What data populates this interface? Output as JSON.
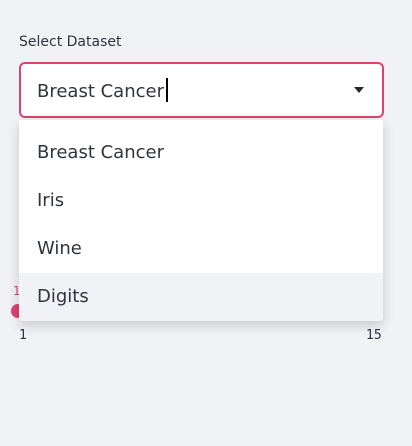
{
  "select": {
    "label": "Select Dataset",
    "value": "Breast Cancer",
    "options": [
      {
        "label": "Breast Cancer"
      },
      {
        "label": "Iris"
      },
      {
        "label": "Wine"
      },
      {
        "label": "Digits"
      }
    ],
    "highlighted_option": "Digits"
  },
  "slider": {
    "min_label": "1",
    "max_label": "15",
    "peek_label": "1"
  },
  "colors": {
    "accent": "#e0416d",
    "background": "#f0f2f6",
    "text": "#31333f"
  },
  "icons": {
    "dropdown": "chevron-down-icon"
  }
}
